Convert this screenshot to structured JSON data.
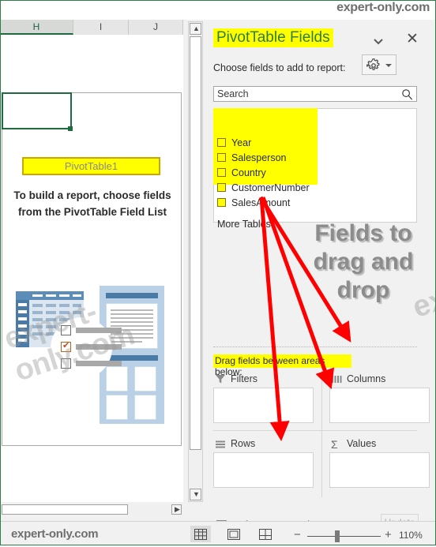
{
  "watermark": {
    "top": "expert-only.com",
    "sheet": "expert-only.com",
    "pane": "expert-only.com",
    "status": "expert-only.com"
  },
  "worksheet": {
    "columns": [
      "H",
      "I",
      "J"
    ],
    "selected_column": "H",
    "pivot_placeholder_title": "PivotTable1",
    "hint_line1": "To build a report, choose fields",
    "hint_line2": "from the PivotTable Field List"
  },
  "pane": {
    "title": "PivotTable Fields",
    "chevron_icon": "chevron-down-icon",
    "close_icon": "close-icon",
    "choose_label": "Choose fields to add to report:",
    "gear_icon": "gear-icon",
    "tools_dropdown_icon": "chevron-down-icon",
    "search": {
      "placeholder": "Search",
      "value": "",
      "icon": "search-icon"
    },
    "fields": [
      {
        "label": "Year",
        "checked": false
      },
      {
        "label": "Salesperson",
        "checked": false
      },
      {
        "label": "Country",
        "checked": false
      },
      {
        "label": "CustomerNumber",
        "checked": false
      },
      {
        "label": "SalesAmount",
        "checked": false
      }
    ],
    "more_tables": "More Tables...",
    "drag_fields_label": "Drag fields between areas below:",
    "areas": [
      {
        "label": "Filters",
        "icon": "filter-funnel-icon",
        "items": []
      },
      {
        "label": "Columns",
        "icon": "columns-icon",
        "items": []
      },
      {
        "label": "Rows",
        "icon": "rows-icon",
        "items": []
      },
      {
        "label": "Values",
        "icon": "sigma-icon",
        "items": []
      }
    ],
    "defer_layout_update": {
      "label": "Defer Layout Update",
      "checked": false
    },
    "update_button": "Update"
  },
  "annotation": {
    "text": "Fields to drag and drop",
    "color": "#8c8c8c",
    "arrow_color": "#ff0000",
    "arrow_count": 3
  },
  "status_bar": {
    "view_normal_icon": "grid-view-icon",
    "view_pagelayout_icon": "page-layout-icon",
    "view_pagebreak_icon": "page-break-icon",
    "zoom_out_icon": "minus-icon",
    "zoom_in_icon": "plus-icon",
    "zoom_level": "110%"
  },
  "colors": {
    "highlight": "#ffff00",
    "excel_green": "#2f7d46",
    "accent_blue": "#4a7ba7"
  }
}
